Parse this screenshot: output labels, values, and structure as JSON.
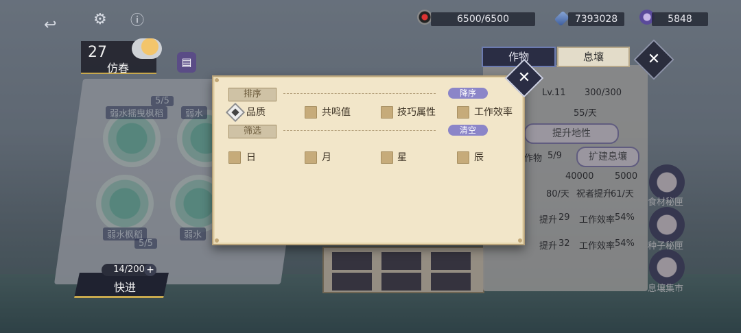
{
  "top_bar": {
    "stamina": "6500/6500",
    "gems": "7393028",
    "crystals": "5848",
    "icons": [
      "back-icon",
      "settings-icon",
      "info-icon"
    ]
  },
  "left_info": {
    "day": "27",
    "season": "仿春",
    "weather": "cloudy-sun",
    "plant_labels": [
      "弱水摇曳枫稻",
      "弱水",
      "弱水枫稻",
      "弱水"
    ],
    "plant_counts": [
      "5/5",
      "5/5"
    ],
    "slots": "14/200",
    "quick_label": "快进"
  },
  "right_panel": {
    "tabs": [
      "作物",
      "息壤"
    ],
    "level_label": "Lv.11",
    "capacity": "300/300",
    "rate": "55/天",
    "upgrade_button": "提升地性",
    "crop_label": "作物",
    "crop_count": "5/9",
    "expand_button": "扩建息壤",
    "cost_1": "40000",
    "cost_2": "5000",
    "produce_rate": "80/天",
    "bless_label": "祝者提升",
    "bless_value": "61/天",
    "rows": [
      {
        "boost_label": "提升",
        "boost": "29",
        "eff_label": "工作效率",
        "eff": "54%"
      },
      {
        "boost_label": "提升",
        "boost": "32",
        "eff_label": "工作效率",
        "eff": "54%"
      }
    ],
    "side_buttons": [
      "食材秘匣",
      "种子秘匣",
      "息壤集市"
    ]
  },
  "filter_modal": {
    "sort_title": "排序",
    "sort_action": "降序",
    "sort_options": [
      {
        "label": "品质",
        "selected": true
      },
      {
        "label": "共鸣值",
        "selected": false
      },
      {
        "label": "技巧属性",
        "selected": false
      },
      {
        "label": "工作效率",
        "selected": false
      }
    ],
    "filter_title": "筛选",
    "filter_action": "清空",
    "filter_options": [
      {
        "label": "日",
        "checked": false
      },
      {
        "label": "月",
        "checked": false
      },
      {
        "label": "星",
        "checked": false
      },
      {
        "label": "辰",
        "checked": false
      }
    ]
  },
  "colors": {
    "modal_bg": "#f2e6c9",
    "accent_purple": "#8b85c8",
    "checkbox": "#c6ab7a",
    "dark_panel": "#2a2d44"
  }
}
